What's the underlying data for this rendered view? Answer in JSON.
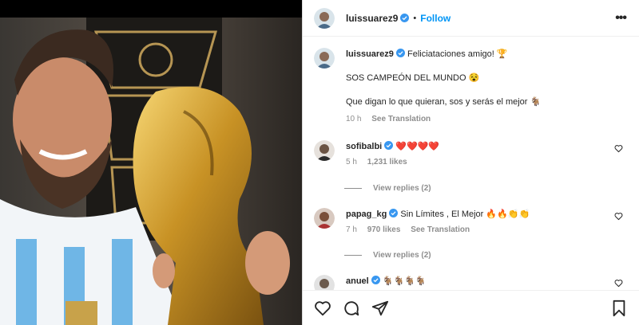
{
  "post": {
    "username": "luissuarez9",
    "separator": "•",
    "follow_label": "Follow",
    "more_label": "•••"
  },
  "caption": {
    "username": "luissuarez9",
    "line1": "Feliciataciones amigo! 🏆",
    "line2": "SOS CAMPEÓN DEL MUNDO 😵",
    "line3": "Que digan lo que quieran, sos y serás el mejor 🐐",
    "time": "10 h",
    "see_translation": "See Translation"
  },
  "comments": [
    {
      "username": "sofibalbi",
      "text": "❤️❤️❤️❤️",
      "time": "5 h",
      "likes": "1,231 likes",
      "view_replies": "View replies (2)"
    },
    {
      "username": "papag_kg",
      "text": "Sin Límites , El Mejor 🔥🔥👏👏",
      "time": "7 h",
      "likes": "970 likes",
      "see_translation": "See Translation",
      "view_replies": "View replies (2)"
    },
    {
      "username": "anuel",
      "text": "🐐🐐🐐🐐"
    }
  ],
  "colors": {
    "accent": "#0095f6",
    "heart": "#ed4956",
    "muted": "#8e8e8e",
    "verified": "#3897f0"
  },
  "icons": [
    "like-icon",
    "comment-icon",
    "share-icon",
    "bookmark-icon",
    "more-icon",
    "verified-badge-icon",
    "heart-icon"
  ]
}
